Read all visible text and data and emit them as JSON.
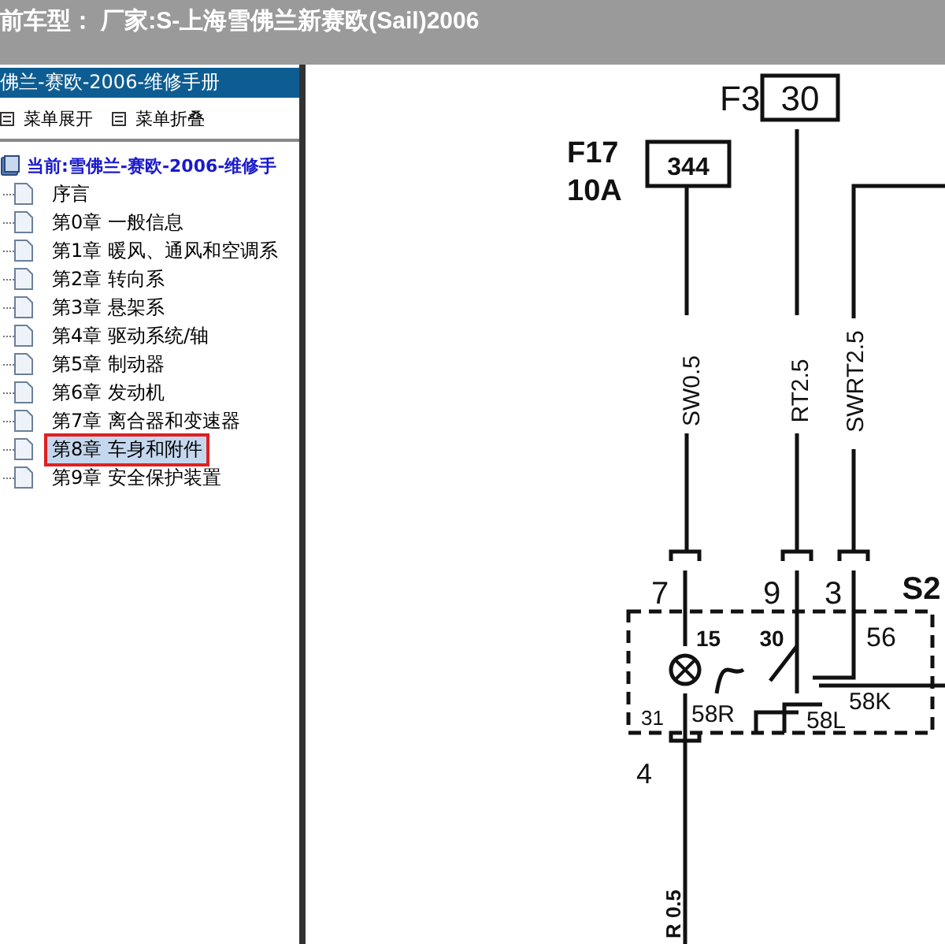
{
  "header": {
    "title": "前车型： 厂家:S-上海雪佛兰新赛欧(Sail)2006"
  },
  "panel": {
    "title": "佛兰-赛欧-2006-维修手册",
    "toolbar": [
      {
        "label": "菜单展开"
      },
      {
        "label": "菜单折叠"
      }
    ],
    "tree": {
      "label": "当前:雪佛兰-赛欧-2006-维修手",
      "children": [
        {
          "label": "序言",
          "selected": false
        },
        {
          "label": "第0章 一般信息",
          "selected": false
        },
        {
          "label": "第1章 暖风、通风和空调系",
          "selected": false
        },
        {
          "label": "第2章 转向系",
          "selected": false
        },
        {
          "label": "第3章 悬架系",
          "selected": false
        },
        {
          "label": "第4章 驱动系统/轴",
          "selected": false
        },
        {
          "label": "第5章 制动器",
          "selected": false
        },
        {
          "label": "第6章 发动机",
          "selected": false
        },
        {
          "label": "第7章 离合器和变速器",
          "selected": false
        },
        {
          "label": "第8章 车身和附件",
          "selected": true
        },
        {
          "label": "第9章 安全保护装置",
          "selected": false
        }
      ]
    }
  },
  "diagram": {
    "labels": [
      "F3",
      "30",
      "F17",
      "10A",
      "344",
      "SW0.5",
      "RT2.5",
      "SWRT2.5",
      "7",
      "9",
      "3",
      "S2",
      "15",
      "30",
      "56",
      "31",
      "58R",
      "58L",
      "58K",
      "4",
      "R 0.5"
    ]
  }
}
